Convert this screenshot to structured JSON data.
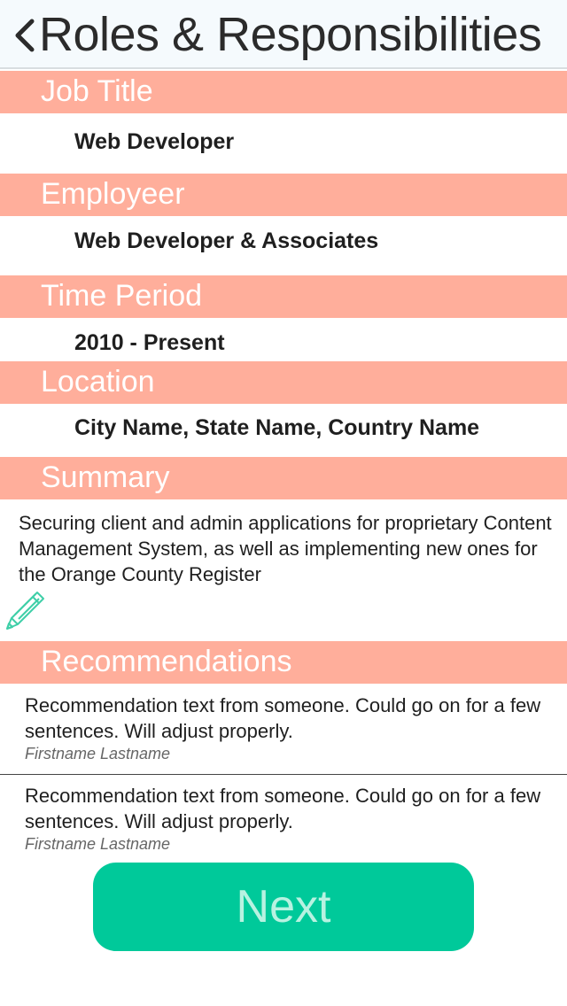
{
  "nav": {
    "title": "Roles & Responsibilities"
  },
  "sections": {
    "job_title": {
      "label": "Job Title",
      "value": "Web Developer"
    },
    "employer": {
      "label": "Employeer",
      "value": "Web Developer & Associates"
    },
    "time_period": {
      "label": "Time Period",
      "value": "2010 - Present"
    },
    "location": {
      "label": "Location",
      "value": "City Name, State Name, Country Name"
    },
    "summary": {
      "label": "Summary",
      "text": "Securing client and admin applications for proprietary Content Management System, as well as implementing new ones for the Orange County Register"
    },
    "recommendations": {
      "label": "Recommendations",
      "items": [
        {
          "text": "Recommendation text from someone.  Could go on for a few sentences.  Will adjust properly.",
          "author": "Firstname Lastname"
        },
        {
          "text": "Recommendation text from someone.  Could go on for a few sentences.  Will adjust properly.",
          "author": "Firstname Lastname"
        }
      ]
    }
  },
  "next_button": {
    "label": "Next"
  },
  "icons": {
    "back": "chevron-left-icon",
    "edit": "pencil-icon"
  },
  "colors": {
    "header_bg": "#ffae9b",
    "accent": "#00c99a"
  }
}
